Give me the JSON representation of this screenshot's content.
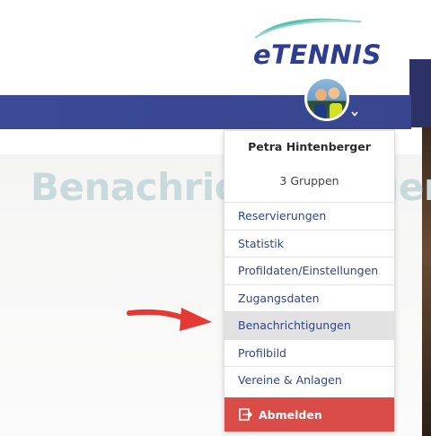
{
  "brand": {
    "logo_text": "eTENNIS"
  },
  "page": {
    "title": "Benachrichtigungen"
  },
  "user_menu": {
    "name": "Petra Hintenberger",
    "groups": "3 Gruppen",
    "items": [
      {
        "label": "Reservierungen"
      },
      {
        "label": "Statistik"
      },
      {
        "label": "Profildaten/Einstellungen"
      },
      {
        "label": "Zugangsdaten"
      },
      {
        "label": "Benachrichtigungen"
      },
      {
        "label": "Profilbild"
      },
      {
        "label": "Vereine & Anlagen"
      }
    ],
    "logout_label": "Abmelden"
  },
  "colors": {
    "navbar": "#3a4a97",
    "logout": "#d94c48",
    "arrow": "#e53935",
    "title": "#c9dadd"
  }
}
